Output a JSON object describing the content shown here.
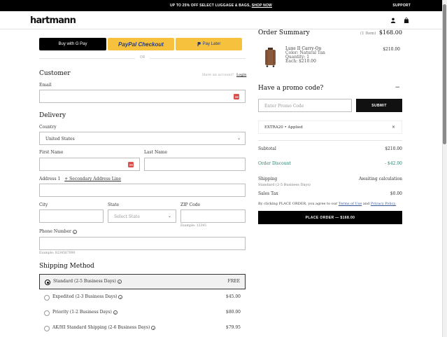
{
  "promo_bar": {
    "text": "UP TO 25% OFF SELECT LUGGAGE & BAGS,",
    "link": "SHOP NOW",
    "support": "SUPPORT"
  },
  "header": {
    "logo": "hartmann"
  },
  "express": {
    "gpay": "Buy with G Pay",
    "paypal": "PayPal Checkout",
    "paylater": "Pay Later",
    "or": "OR"
  },
  "customer": {
    "title": "Customer",
    "account_prompt": "Have an account?",
    "login": "Login",
    "email_label": "Email",
    "email_value": ""
  },
  "delivery": {
    "title": "Delivery",
    "country_label": "Country",
    "country_value": "United States",
    "first_name_label": "First Name",
    "last_name_label": "Last Name",
    "address_label": "Address 1",
    "secondary_link": "+ Secondary Address Line",
    "city_label": "City",
    "state_label": "State",
    "state_placeholder": "Select State",
    "zip_label": "ZIP Code",
    "zip_example": "Example: 12345",
    "phone_label": "Phone Number",
    "phone_example": "Example: 8234567890"
  },
  "shipping": {
    "title": "Shipping Method",
    "options": [
      {
        "name": "Standard (2-5 Business Days)",
        "price": "FREE",
        "selected": true
      },
      {
        "name": "Expedited (2-3 Business Days)",
        "price": "$45.00",
        "selected": false
      },
      {
        "name": "Priority (1-2 Business Days)",
        "price": "$80.00",
        "selected": false
      },
      {
        "name": "AK/HI Standard Shipping (2-6 Business Days)",
        "price": "$79.95",
        "selected": false
      }
    ]
  },
  "summary": {
    "title": "Order Summary",
    "count": "(1 Item)",
    "total": "$168.00",
    "item": {
      "name": "Luxe II Carry-On",
      "color": "Color: Natural Tan",
      "quantity": "Quantity: 1",
      "each": "Each: $210.00",
      "price": "$210.00"
    },
    "promo_title": "Have a promo code?",
    "promo_toggle": "−",
    "promo_placeholder": "Enter Promo Code",
    "submit": "SUBMIT",
    "applied_code": "EXTRA20 • Applied",
    "remove": "×",
    "subtotal_label": "Subtotal",
    "subtotal": "$210.00",
    "discount_label": "Order Discount",
    "discount": "- $42.00",
    "shipping_label": "Shipping",
    "shipping_value": "Awaiting calculation",
    "shipping_sub": "Standard (2-5 Business Days)",
    "tax_label": "Sales Tax",
    "tax": "$0.00",
    "terms_prefix": "By clicking PLACE ORDER, you agree to our",
    "terms_link": "Terms of Use",
    "and": "and",
    "privacy_link": "Privacy Policy.",
    "place_order": "PLACE ORDER — $168.00"
  },
  "colors": {
    "accent_discount": "#2e7d6b",
    "black": "#000000",
    "paypal_yellow": "#f6c23e",
    "card_badge": "#d9534f"
  },
  "icons": [
    "user-icon",
    "bag-icon",
    "google-g-icon",
    "paypal-p-icon",
    "card-badge-icon",
    "chevron-down-icon",
    "info-icon",
    "minus-icon",
    "close-icon"
  ]
}
